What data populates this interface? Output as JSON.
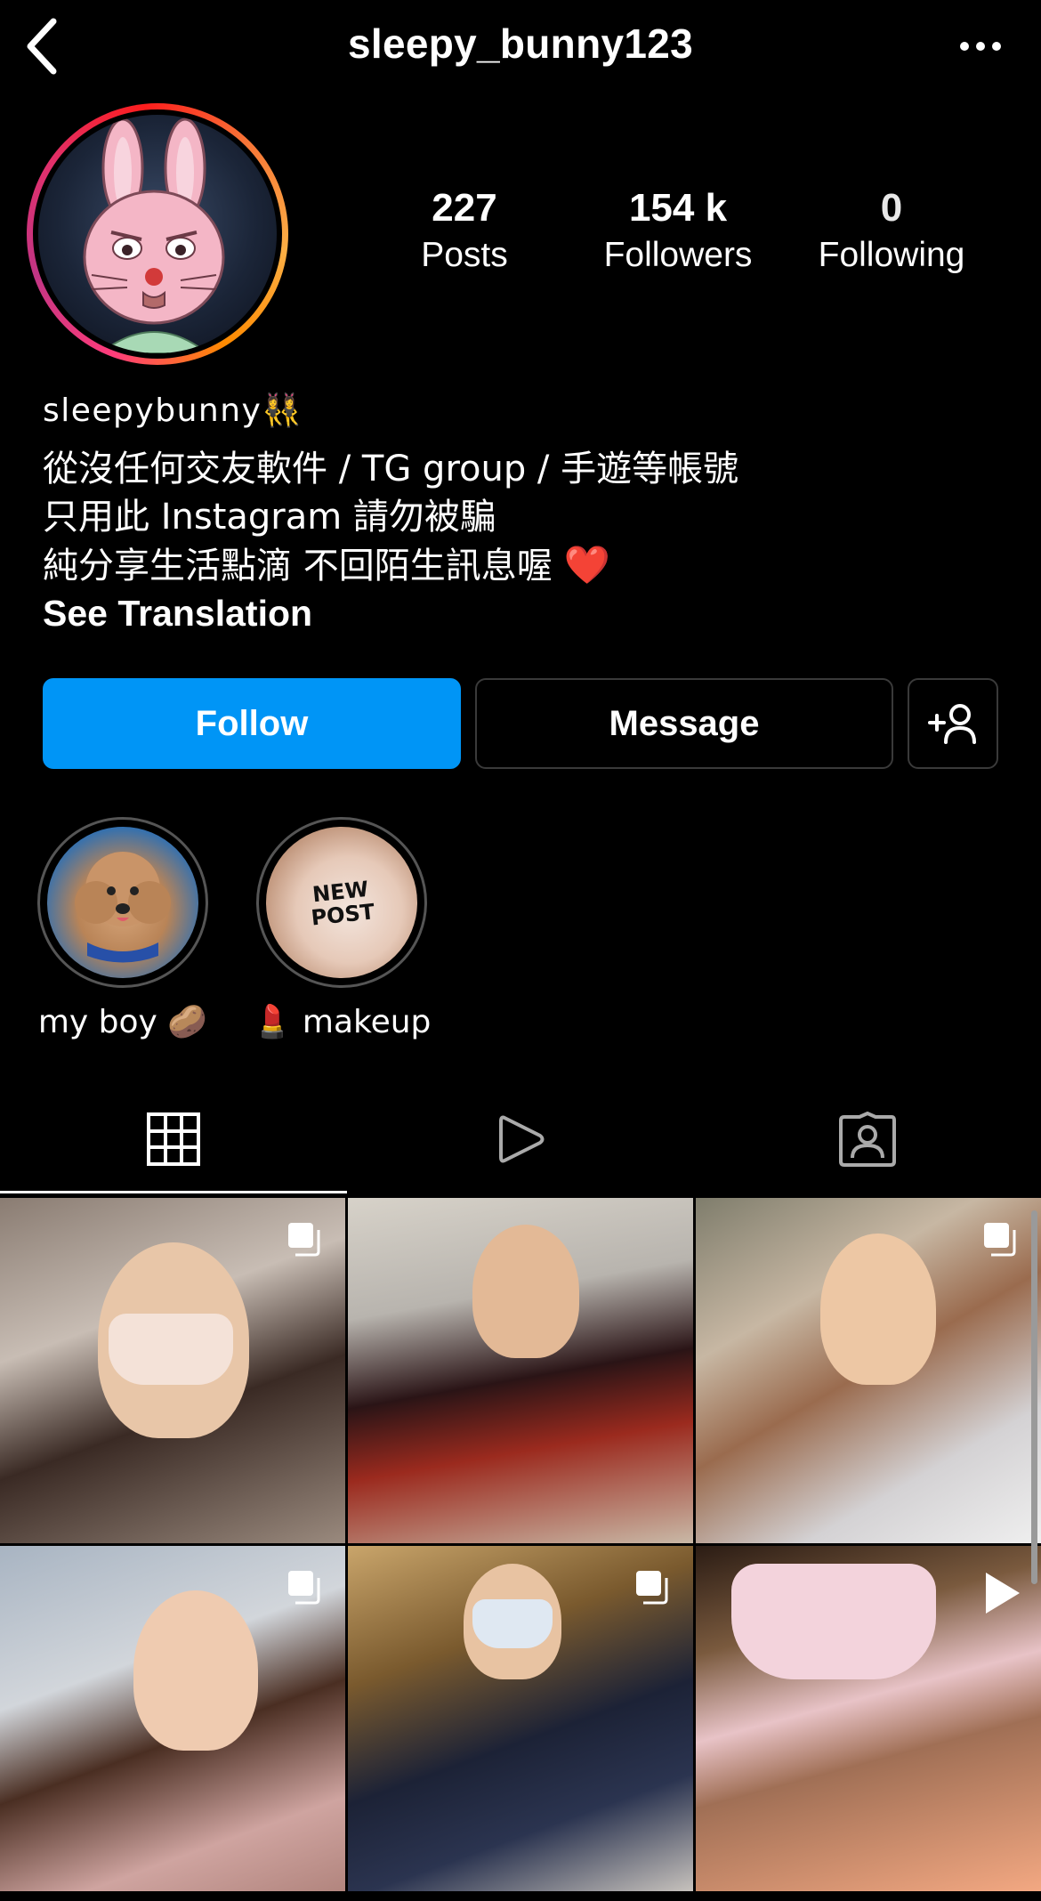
{
  "header": {
    "username": "sleepy_bunny123"
  },
  "stats": {
    "posts_count": "227",
    "posts_label": "Posts",
    "followers_count": "154 k",
    "followers_label": "Followers",
    "following_count": "0",
    "following_label": "Following"
  },
  "bio": {
    "name": "sleepybunny👯‍♀️",
    "line1": "從沒任何交友軟件 / TG group / 手遊等帳號",
    "line2": "只用此 Instagram 請勿被騙",
    "line3": "純分享生活點滴 不回陌生訊息喔",
    "line3_emoji": "❤️",
    "see_translation": "See Translation"
  },
  "actions": {
    "follow_label": "Follow",
    "message_label": "Message"
  },
  "highlights": [
    {
      "label": "my boy 🥔"
    },
    {
      "label": "💄 makeup"
    }
  ],
  "highlight_2_sticker": {
    "line1": "NEW",
    "line2": "POST"
  },
  "tabs": [
    "grid-icon",
    "reels-icon",
    "tagged-icon"
  ],
  "posts": [
    {
      "type": "carousel"
    },
    {
      "type": "photo"
    },
    {
      "type": "carousel"
    },
    {
      "type": "carousel"
    },
    {
      "type": "carousel"
    },
    {
      "type": "reel"
    }
  ],
  "colors": {
    "follow_button": "#0095f6",
    "background": "#000000",
    "heart": "#e3203a"
  }
}
